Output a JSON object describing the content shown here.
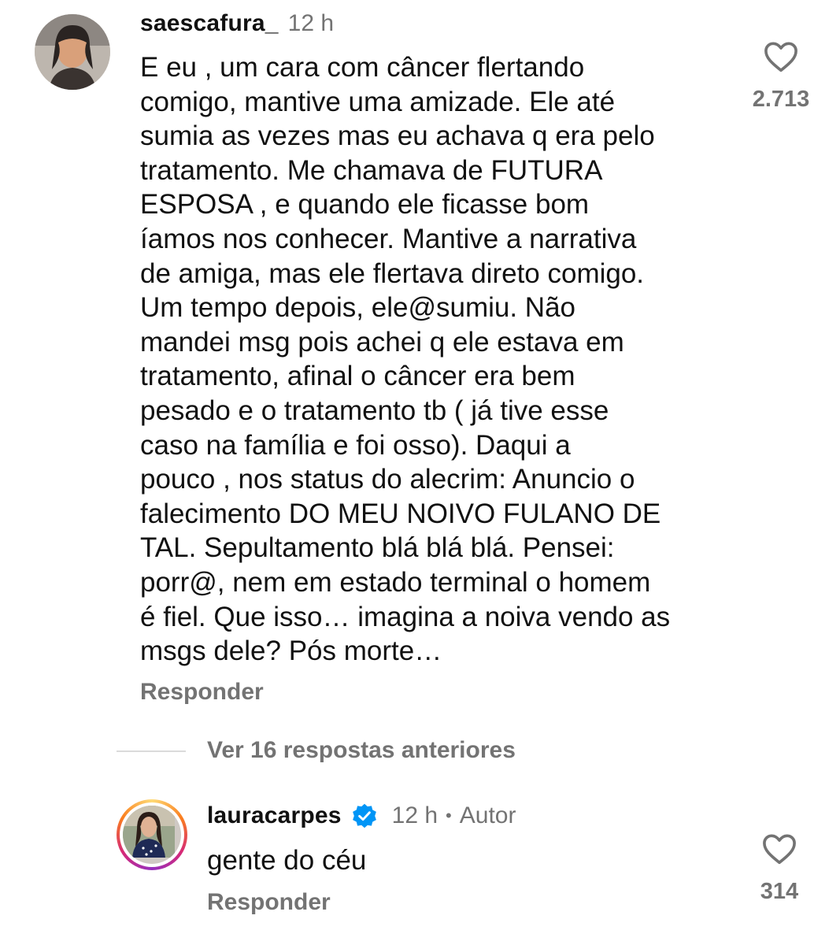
{
  "comment1": {
    "username": "saescafura_",
    "time": "12 h",
    "text": "E eu , um cara com câncer flertando\ncomigo, mantive uma amizade. Ele até\nsumia as vezes mas eu achava q era pelo\ntratamento. Me chamava de FUTURA\nESPOSA , e quando ele ficasse bom\níamos nos conhecer. Mantive a narrativa\nde amiga, mas ele flertava direto comigo.\nUm tempo depois, ele@sumiu. Não\nmandei msg pois achei q ele estava em\ntratamento, afinal o câncer era bem\npesado e o tratamento tb ( já tive esse\ncaso na família e foi osso). Daqui a\npouco , nos status do alecrim: Anuncio o\nfalecimento DO MEU NOIVO FULANO DE\nTAL. Sepultamento blá blá blá. Pensei:\nporr@, nem em estado terminal o homem\né fiel. Que isso… imagina a noiva vendo as\nmsgs dele? Pós morte…",
    "reply_label": "Responder",
    "likes": "2.713",
    "heart_icon": "heart-outline-icon"
  },
  "thread": {
    "view_replies_label": "Ver 16 respostas anteriores"
  },
  "comment2": {
    "username": "lauracarpes",
    "verified_icon": "verified-badge-icon",
    "time": "12 h",
    "separator": "•",
    "author_label": "Autor",
    "text": "gente do céu",
    "reply_label": "Responder",
    "likes": "314",
    "heart_icon": "heart-outline-icon"
  },
  "colors": {
    "text": "#111111",
    "secondary": "#737373",
    "verified": "#0095f6",
    "divider": "#dbdbdb"
  }
}
